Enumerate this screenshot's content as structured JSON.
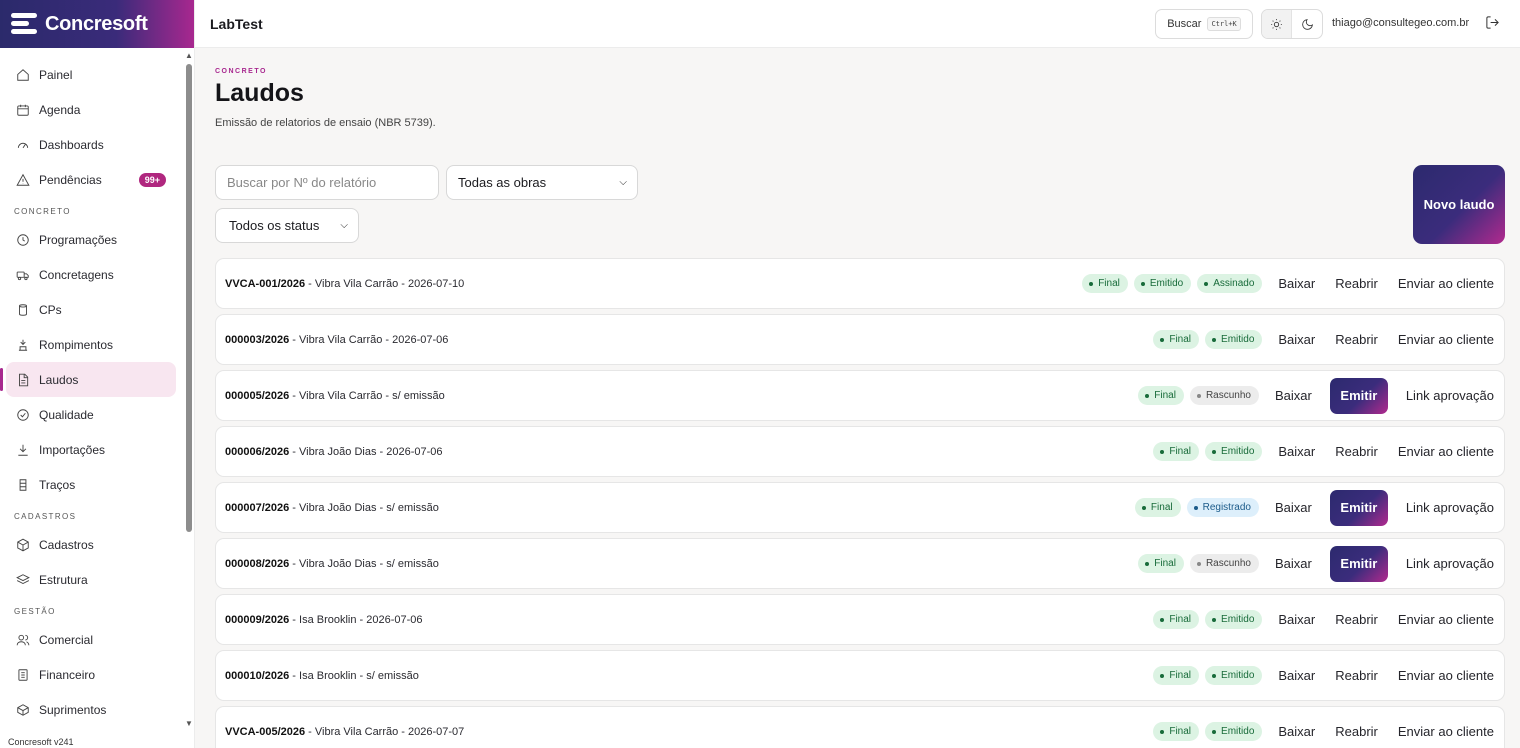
{
  "brand": {
    "name": "Concresoft"
  },
  "topbar": {
    "app_title": "LabTest",
    "search_label": "Buscar",
    "search_shortcut": "Ctrl+K",
    "user_email": "thiago@consultegeo.com.br"
  },
  "sidebar": {
    "items": [
      {
        "label": "Painel",
        "icon": "home-icon"
      },
      {
        "label": "Agenda",
        "icon": "calendar-icon"
      },
      {
        "label": "Dashboards",
        "icon": "gauge-icon"
      },
      {
        "label": "Pendências",
        "icon": "warning-icon",
        "badge": "99+"
      }
    ],
    "section_concreto": "CONCRETO",
    "concreto_items": [
      {
        "label": "Programações",
        "icon": "clock-icon"
      },
      {
        "label": "Concretagens",
        "icon": "truck-icon"
      },
      {
        "label": "CPs",
        "icon": "cylinder-icon"
      },
      {
        "label": "Rompimentos",
        "icon": "press-icon"
      },
      {
        "label": "Laudos",
        "icon": "document-icon",
        "active": true
      },
      {
        "label": "Qualidade",
        "icon": "check-circle-icon"
      },
      {
        "label": "Importações",
        "icon": "download-icon"
      },
      {
        "label": "Traços",
        "icon": "flask-icon"
      }
    ],
    "section_cadastros": "CADASTROS",
    "cadastros_items": [
      {
        "label": "Cadastros",
        "icon": "cube-icon"
      },
      {
        "label": "Estrutura",
        "icon": "layers-icon"
      }
    ],
    "section_gestao": "GESTÃO",
    "gestao_items": [
      {
        "label": "Comercial",
        "icon": "users-icon"
      },
      {
        "label": "Financeiro",
        "icon": "ledger-icon"
      },
      {
        "label": "Suprimentos",
        "icon": "box-icon"
      }
    ],
    "version": "Concresoft v241"
  },
  "page": {
    "eyebrow": "CONCRETO",
    "title": "Laudos",
    "subtitle": "Emissão de relatorios de ensaio (NBR 5739).",
    "search_placeholder": "Buscar por Nº do relatório",
    "obras_select": "Todas as obras",
    "status_select": "Todos os status",
    "new_button": "Novo laudo"
  },
  "reports": [
    {
      "number": "VVCA-001/2026",
      "details": " - Vibra Vila Carrão - 2026-07-10",
      "statuses": [
        [
          "Final",
          "green"
        ],
        [
          "Emitido",
          "green"
        ],
        [
          "Assinado",
          "green"
        ]
      ],
      "actions": [
        "Baixar",
        "Reabrir",
        "Enviar ao cliente"
      ],
      "emit": false
    },
    {
      "number": "000003/2026",
      "details": " - Vibra Vila Carrão - 2026-07-06",
      "statuses": [
        [
          "Final",
          "green"
        ],
        [
          "Emitido",
          "green"
        ]
      ],
      "actions": [
        "Baixar",
        "Reabrir",
        "Enviar ao cliente"
      ],
      "emit": false
    },
    {
      "number": "000005/2026",
      "details": " - Vibra Vila Carrão - s/ emissão",
      "statuses": [
        [
          "Final",
          "green"
        ],
        [
          "Rascunho",
          "gray"
        ]
      ],
      "actions": [
        "Baixar",
        "Emitir",
        "Link aprovação"
      ],
      "emit": true
    },
    {
      "number": "000006/2026",
      "details": " - Vibra João Dias - 2026-07-06",
      "statuses": [
        [
          "Final",
          "green"
        ],
        [
          "Emitido",
          "green"
        ]
      ],
      "actions": [
        "Baixar",
        "Reabrir",
        "Enviar ao cliente"
      ],
      "emit": false
    },
    {
      "number": "000007/2026",
      "details": " - Vibra João Dias - s/ emissão",
      "statuses": [
        [
          "Final",
          "green"
        ],
        [
          "Registrado",
          "blue"
        ]
      ],
      "actions": [
        "Baixar",
        "Emitir",
        "Link aprovação"
      ],
      "emit": true
    },
    {
      "number": "000008/2026",
      "details": " - Vibra João Dias - s/ emissão",
      "statuses": [
        [
          "Final",
          "green"
        ],
        [
          "Rascunho",
          "gray"
        ]
      ],
      "actions": [
        "Baixar",
        "Emitir",
        "Link aprovação"
      ],
      "emit": true
    },
    {
      "number": "000009/2026",
      "details": " - Isa Brooklin - 2026-07-06",
      "statuses": [
        [
          "Final",
          "green"
        ],
        [
          "Emitido",
          "green"
        ]
      ],
      "actions": [
        "Baixar",
        "Reabrir",
        "Enviar ao cliente"
      ],
      "emit": false
    },
    {
      "number": "000010/2026",
      "details": " - Isa Brooklin - s/ emissão",
      "statuses": [
        [
          "Final",
          "green"
        ],
        [
          "Emitido",
          "green"
        ]
      ],
      "actions": [
        "Baixar",
        "Reabrir",
        "Enviar ao cliente"
      ],
      "emit": false
    },
    {
      "number": "VVCA-005/2026",
      "details": " - Vibra Vila Carrão - 2026-07-07",
      "statuses": [
        [
          "Final",
          "green"
        ],
        [
          "Emitido",
          "green"
        ]
      ],
      "actions": [
        "Baixar",
        "Reabrir",
        "Enviar ao cliente"
      ],
      "emit": false
    }
  ],
  "colors": {
    "brand_dark": "#2c2a6e",
    "brand_accent": "#a8288f",
    "status_green": "#dcf3e3"
  }
}
